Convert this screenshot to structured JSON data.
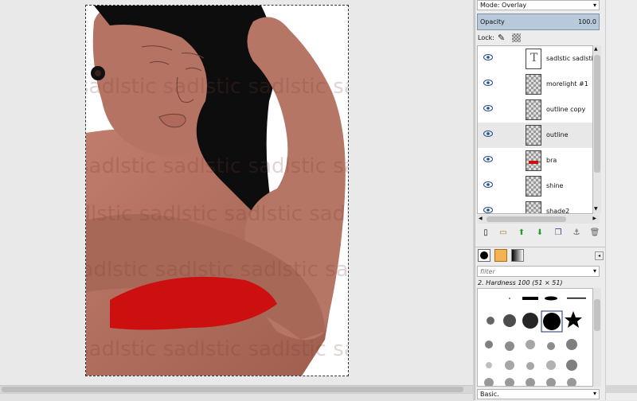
{
  "canvas": {
    "watermark_text": "sadlstic sadlstic sadlstic sadlstic sadlstic"
  },
  "layers_panel": {
    "mode_label": "Mode: Overlay",
    "opacity_label": "Opacity",
    "opacity_value": "100.0",
    "lock_label": "Lock:",
    "layers": [
      {
        "name": "sadlstic sadlstic sa",
        "thumb": "text",
        "visible": true
      },
      {
        "name": "morelight #1",
        "thumb": "dark",
        "visible": true
      },
      {
        "name": "outline copy",
        "thumb": "checker",
        "visible": true
      },
      {
        "name": "outline",
        "thumb": "checker",
        "visible": true,
        "selected": true
      },
      {
        "name": "bra",
        "thumb": "red",
        "visible": true
      },
      {
        "name": "shine",
        "thumb": "checker",
        "visible": true
      },
      {
        "name": "shade2",
        "thumb": "checker",
        "visible": true
      }
    ],
    "toolbar_icons": [
      "new-layer-icon",
      "new-group-icon",
      "raise-layer-icon",
      "lower-layer-icon",
      "duplicate-layer-icon",
      "anchor-layer-icon",
      "delete-layer-icon"
    ]
  },
  "brushes_panel": {
    "filter_placeholder": "filter",
    "selected_brush": "2. Hardness 100 (51 × 51)",
    "preset_value": "Basic."
  },
  "colors": {
    "accent_selection": "#b8c9db",
    "pattern_swatch": "#f4b350",
    "skin": "#b07060",
    "bra_red": "#cc1010"
  }
}
